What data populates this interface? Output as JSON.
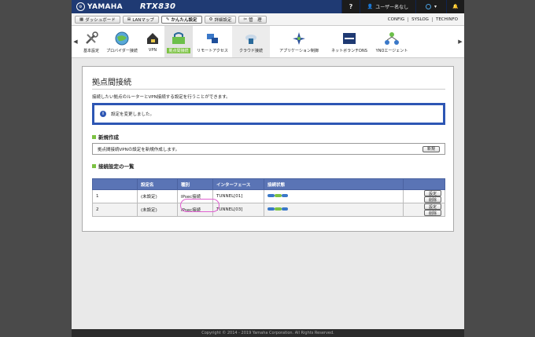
{
  "brand": {
    "logo": "YAMAHA",
    "model": "RTX830"
  },
  "topbar": {
    "help": "?",
    "user": "ユーザー名なし",
    "status_icon": "power-status-icon",
    "bell_icon": "bell-icon"
  },
  "nav": {
    "buttons": [
      {
        "label": "ダッシュボード",
        "icon": "dashboard-icon"
      },
      {
        "label": "LANマップ",
        "icon": "lanmap-icon"
      },
      {
        "label": "かんたん設定",
        "icon": "easy-setup-icon"
      },
      {
        "label": "詳細設定",
        "icon": "gear-icon"
      },
      {
        "label": "管　理",
        "icon": "tools-icon"
      }
    ],
    "links": [
      "CONFIG",
      "SYSLOG",
      "TECHINFO"
    ]
  },
  "icons": [
    {
      "label": "基本設定"
    },
    {
      "label": "プロバイダー接続"
    },
    {
      "label": "VPN"
    },
    {
      "label": "拠点間接続"
    },
    {
      "label": "リモートアクセス"
    },
    {
      "label": "クラウド接続"
    },
    {
      "label": "アプリケーション制御"
    },
    {
      "label": "ネットボランチDNS"
    },
    {
      "label": "YNOエージェント"
    }
  ],
  "page": {
    "title": "拠点間接続",
    "description": "接続したい拠点のルーターとVPN接続する設定を行うことができます。",
    "notice": "設定を変更しました。",
    "section_new": "新規作成",
    "new_text": "拠点間接続VPNの設定を新規作成します。",
    "new_button": "新規",
    "section_list": "接続設定の一覧"
  },
  "table": {
    "headers": [
      "",
      "設定名",
      "種別",
      "インターフェース",
      "接続状態",
      ""
    ],
    "rows": [
      {
        "no": "1",
        "name": "(未設定)",
        "type": "IPsec接続",
        "iface": "TUNNEL[01]",
        "btn_set": "設定",
        "btn_del": "削除"
      },
      {
        "no": "2",
        "name": "(未設定)",
        "type": "IPsec接続",
        "iface": "TUNNEL[03]",
        "btn_set": "設定",
        "btn_del": "削除"
      }
    ]
  },
  "footer": "Copyright © 2014 - 2019 Yamaha Corporation. All Rights Reserved.",
  "colors": {
    "header": "#1f3a73",
    "accent": "#7cc243",
    "table_head": "#5a74b5",
    "notice_border": "#2d56b4"
  }
}
